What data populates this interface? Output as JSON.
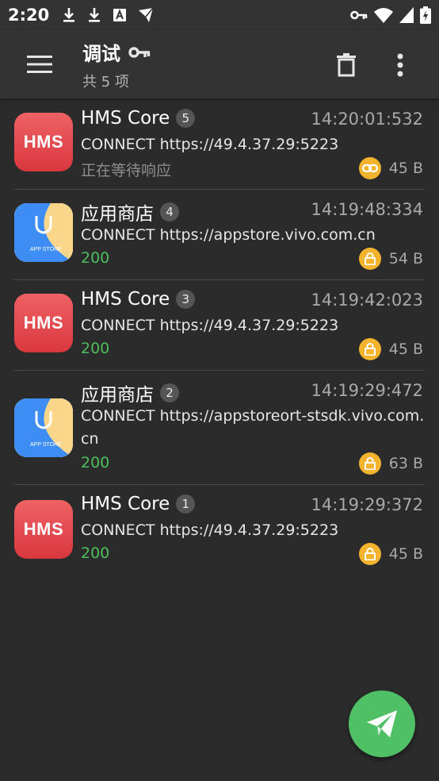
{
  "status_bar": {
    "time": "2:20",
    "left_icons": [
      "download-icon",
      "download-icon",
      "a-box-icon",
      "plane-icon"
    ],
    "right_icons": [
      "key-icon",
      "wifi-icon",
      "signal-icon",
      "battery-icon"
    ]
  },
  "app_bar": {
    "title": "调试",
    "subtitle": "共 5 项",
    "title_icon": "key-icon",
    "actions": [
      "delete-icon",
      "more-vert-icon"
    ]
  },
  "requests": [
    {
      "app": "HMS Core",
      "icon": "hms",
      "index": "5",
      "time": "14:20:01:532",
      "url": "CONNECT https://49.4.37.29:5223",
      "status": "正在等待响应",
      "status_type": "pending",
      "secure_icon": "link-icon",
      "size": "45 B"
    },
    {
      "app": "应用商店",
      "icon": "store",
      "index": "4",
      "time": "14:19:48:334",
      "url": "CONNECT https://appstore.vivo.com.cn",
      "status": "200",
      "status_type": "ok",
      "secure_icon": "lock-icon",
      "size": "54 B"
    },
    {
      "app": "HMS Core",
      "icon": "hms",
      "index": "3",
      "time": "14:19:42:023",
      "url": "CONNECT https://49.4.37.29:5223",
      "status": "200",
      "status_type": "ok",
      "secure_icon": "lock-icon",
      "size": "45 B"
    },
    {
      "app": "应用商店",
      "icon": "store",
      "index": "2",
      "time": "14:19:29:472",
      "url": "CONNECT https://appstoreort-stsdk.vivo.com.cn",
      "status": "200",
      "status_type": "ok",
      "secure_icon": "lock-icon",
      "size": "63 B"
    },
    {
      "app": "HMS Core",
      "icon": "hms",
      "index": "1",
      "time": "14:19:29:372",
      "url": "CONNECT https://49.4.37.29:5223",
      "status": "200",
      "status_type": "ok",
      "secure_icon": "lock-icon",
      "size": "45 B"
    }
  ],
  "icon_text": {
    "hms": "HMS",
    "store": "APP STORE"
  },
  "colors": {
    "ok": "#4cbf5c",
    "pending": "#8d8d8d",
    "lock": "#f3b32c",
    "fab": "#4fc065",
    "hms": "#e04a4f"
  },
  "fab": {
    "icon": "send-icon"
  }
}
